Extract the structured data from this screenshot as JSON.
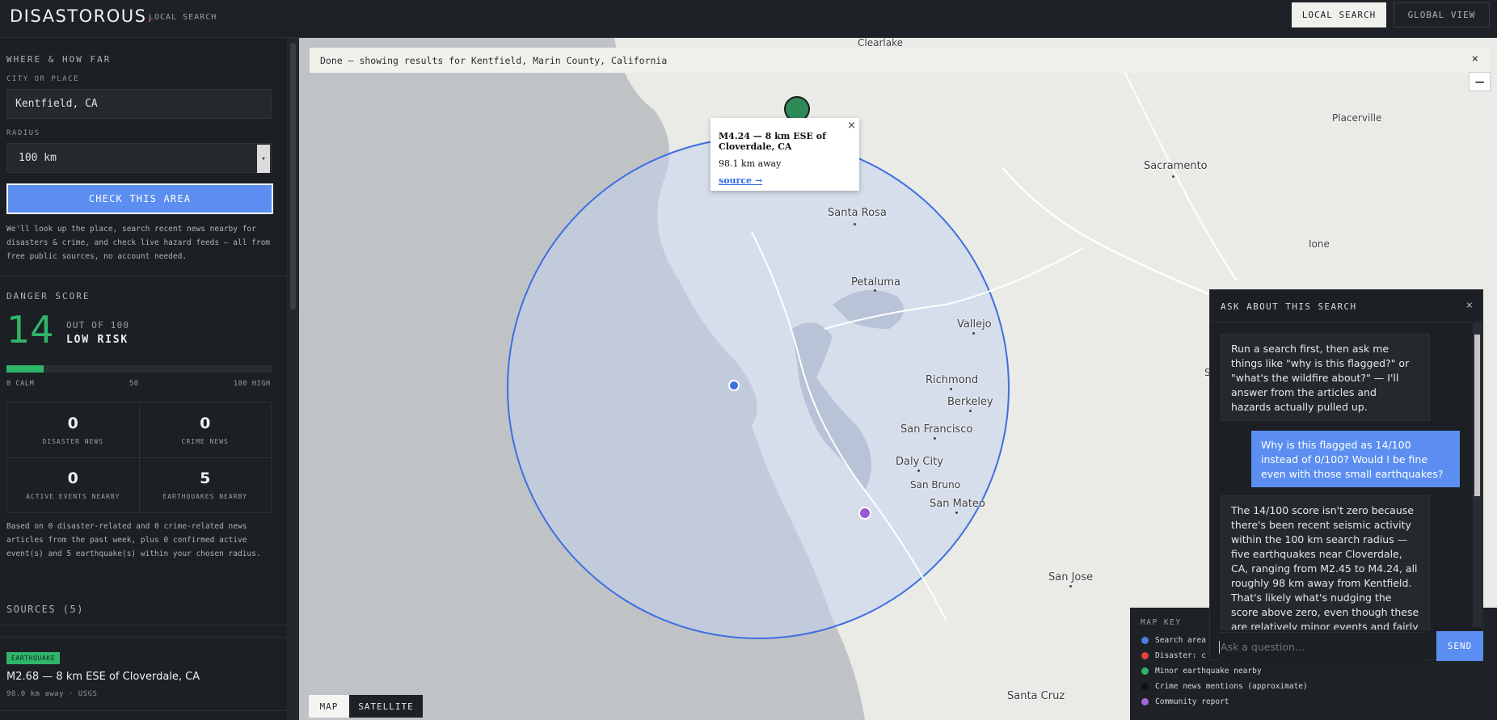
{
  "header": {
    "brand": "DISASTOROUS",
    "brand_dot": ".",
    "subtitle": "LOCAL SEARCH",
    "nav": [
      {
        "label": "LOCAL SEARCH",
        "active": true
      },
      {
        "label": "GLOBAL VIEW",
        "active": false
      }
    ]
  },
  "sidebar": {
    "where_title": "WHERE & HOW FAR",
    "city_label": "CITY OR PLACE",
    "city_value": "Kentfield, CA",
    "radius_label": "RADIUS",
    "radius_value": "100 km",
    "check_button": "CHECK THIS AREA",
    "help_text": "We'll look up the place, search recent news nearby for disasters & crime, and check live hazard feeds — all from free public sources, no account needed.",
    "danger": {
      "title": "DANGER SCORE",
      "score": "14",
      "score_value": 14,
      "out_of": "OUT OF 100",
      "risk": "LOW RISK",
      "scale_low": "0 CALM",
      "scale_mid": "50",
      "scale_high": "100 HIGH",
      "color": "#2fb56a"
    },
    "stats": [
      {
        "value": "0",
        "label": "DISASTER NEWS"
      },
      {
        "value": "0",
        "label": "CRIME NEWS"
      },
      {
        "value": "0",
        "label": "ACTIVE EVENTS NEARBY"
      },
      {
        "value": "5",
        "label": "EARTHQUAKES NEARBY"
      }
    ],
    "summary": "Based on 0 disaster-related and 0 crime-related news articles from the past week, plus 0 confirmed active event(s) and 5 earthquake(s) within your chosen radius.",
    "sources_title": "SOURCES (5)",
    "source_item": {
      "badge": "EARTHQUAKE",
      "title": "M2.68 — 8 km ESE of Cloverdale, CA",
      "meta": "98.0 km away · USGS"
    }
  },
  "map": {
    "banner": "Done — showing results for Kentfield, Marin County, California",
    "banner_close": "×",
    "zoom_out": "−",
    "places": {
      "clearlake": "Clearlake",
      "placerville": "Placerville",
      "sacramento": "Sacramento",
      "ione": "Ione",
      "santa_rosa": "Santa Rosa",
      "petaluma": "Petaluma",
      "vallejo": "Vallejo",
      "richmond": "Richmond",
      "berkeley": "Berkeley",
      "san_francisco": "San Francisco",
      "daly_city": "Daly City",
      "san_bruno": "San Bruno",
      "san_mateo": "San Mateo",
      "san_jose": "San Jose",
      "santa_cruz": "Santa Cruz",
      "edge_s": "S"
    },
    "popup": {
      "title": "M4.24 — 8 km ESE of Cloverdale, CA",
      "distance": "98.1 km away",
      "link": "source →",
      "close": "×"
    },
    "toggle": [
      {
        "label": "MAP",
        "active": true
      },
      {
        "label": "SATELLITE",
        "active": false
      }
    ],
    "search_circle_color": "#3d6fe0",
    "center_marker_color": "#3d6fe0",
    "community_marker_color": "#9b59d0",
    "quake_marker_color": "#2e8b57"
  },
  "map_key": {
    "title": "MAP KEY",
    "items": [
      {
        "label": "Search area",
        "color": "#4a7fe8"
      },
      {
        "label": "Disaster: c",
        "color": "#e0453a"
      },
      {
        "label": "Minor earthquake nearby",
        "color": "#2fb56a"
      },
      {
        "label": "Crime news mentions (approximate)",
        "color": "#111111"
      },
      {
        "label": "Community report",
        "color": "#a36ad6"
      }
    ]
  },
  "chat": {
    "title": "ASK ABOUT THIS SEARCH",
    "close": "×",
    "messages": [
      {
        "role": "bot",
        "text": "Run a search first, then ask me things like \"why is this flagged?\" or \"what's the wildfire about?\" — I'll answer from the articles and hazards actually pulled up."
      },
      {
        "role": "user",
        "text": "Why is this flagged as 14/100 instead of 0/100? Would I be fine even with those small earthquakes?"
      },
      {
        "role": "bot",
        "text": "The 14/100 score isn't zero because there's been recent seismic activity within the 100 km search radius — five earthquakes near Cloverdale, CA, ranging from M2.45 to M4.24, all roughly 98 km away from Kentfield. That's likely what's nudging the score above zero, even though these are relatively minor events and fairly"
      }
    ],
    "input_placeholder": "Ask a question...",
    "send": "SEND"
  }
}
